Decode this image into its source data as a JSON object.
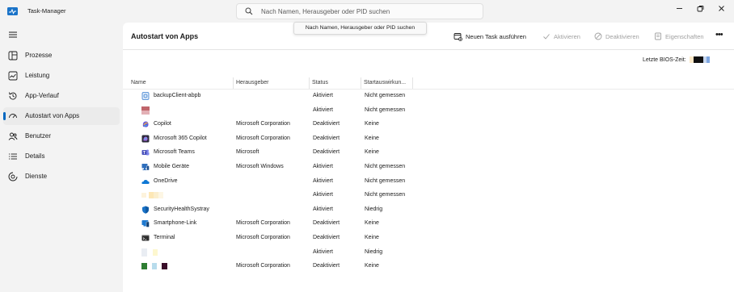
{
  "window": {
    "title": "Task-Manager",
    "search_placeholder": "Nach Namen, Herausgeber oder PID suchen",
    "search_tooltip": "Nach Namen, Herausgeber oder PID suchen"
  },
  "sidebar": {
    "items": [
      {
        "label": "Prozesse",
        "icon": "processes-icon"
      },
      {
        "label": "Leistung",
        "icon": "performance-icon"
      },
      {
        "label": "App-Verlauf",
        "icon": "history-icon"
      },
      {
        "label": "Autostart von Apps",
        "icon": "startup-icon",
        "active": true
      },
      {
        "label": "Benutzer",
        "icon": "users-icon"
      },
      {
        "label": "Details",
        "icon": "details-icon"
      },
      {
        "label": "Dienste",
        "icon": "services-icon"
      }
    ]
  },
  "main": {
    "title": "Autostart von Apps",
    "toolbar": {
      "new_task": "Neuen Task ausführen",
      "enable": "Aktivieren",
      "disable": "Deaktivieren",
      "properties": "Eigenschaften"
    },
    "bios_label": "Letzte BIOS-Zeit:",
    "columns": {
      "name": "Name",
      "publisher": "Herausgeber",
      "status": "Status",
      "impact": "Startauswirkun..."
    },
    "rows": [
      {
        "name": "backupClient-abpb",
        "publisher": "",
        "status": "Aktiviert",
        "impact": "Nicht gemessen",
        "icon": "backup-client-icon"
      },
      {
        "name": "",
        "publisher": "",
        "status": "Aktiviert",
        "impact": "Nicht gemessen",
        "icon": "redacted-app-icon"
      },
      {
        "name": "Copilot",
        "publisher": "Microsoft Corporation",
        "status": "Deaktiviert",
        "impact": "Keine",
        "icon": "copilot-icon"
      },
      {
        "name": "Microsoft 365 Copilot",
        "publisher": "Microsoft Corporation",
        "status": "Deaktiviert",
        "impact": "Keine",
        "icon": "m365-copilot-icon"
      },
      {
        "name": "Microsoft Teams",
        "publisher": "Microsoft",
        "status": "Deaktiviert",
        "impact": "Keine",
        "icon": "teams-icon"
      },
      {
        "name": "Mobile Geräte",
        "publisher": "Microsoft Windows",
        "status": "Aktiviert",
        "impact": "Nicht gemessen",
        "icon": "mobile-devices-icon"
      },
      {
        "name": "OneDrive",
        "publisher": "",
        "status": "Aktiviert",
        "impact": "Nicht gemessen",
        "icon": "onedrive-icon"
      },
      {
        "name": "",
        "publisher": "",
        "status": "Aktiviert",
        "impact": "Nicht gemessen",
        "icon": "redacted-app-icon"
      },
      {
        "name": "SecurityHealthSystray",
        "publisher": "",
        "status": "Aktiviert",
        "impact": "Niedrig",
        "icon": "security-shield-icon"
      },
      {
        "name": "Smartphone-Link",
        "publisher": "Microsoft Corporation",
        "status": "Deaktiviert",
        "impact": "Keine",
        "icon": "phone-link-icon"
      },
      {
        "name": "Terminal",
        "publisher": "Microsoft Corporation",
        "status": "Deaktiviert",
        "impact": "Keine",
        "icon": "terminal-icon"
      },
      {
        "name": "",
        "publisher": "",
        "status": "Aktiviert",
        "impact": "Niedrig",
        "icon": "redacted-app-icon"
      },
      {
        "name": "",
        "publisher": "Microsoft Corporation",
        "status": "Deaktiviert",
        "impact": "Keine",
        "icon": "redacted-app-icon"
      }
    ]
  },
  "colors": {
    "accent": "#0067c0",
    "window_bg": "#f3f3f3",
    "panel_bg": "#ffffff"
  }
}
